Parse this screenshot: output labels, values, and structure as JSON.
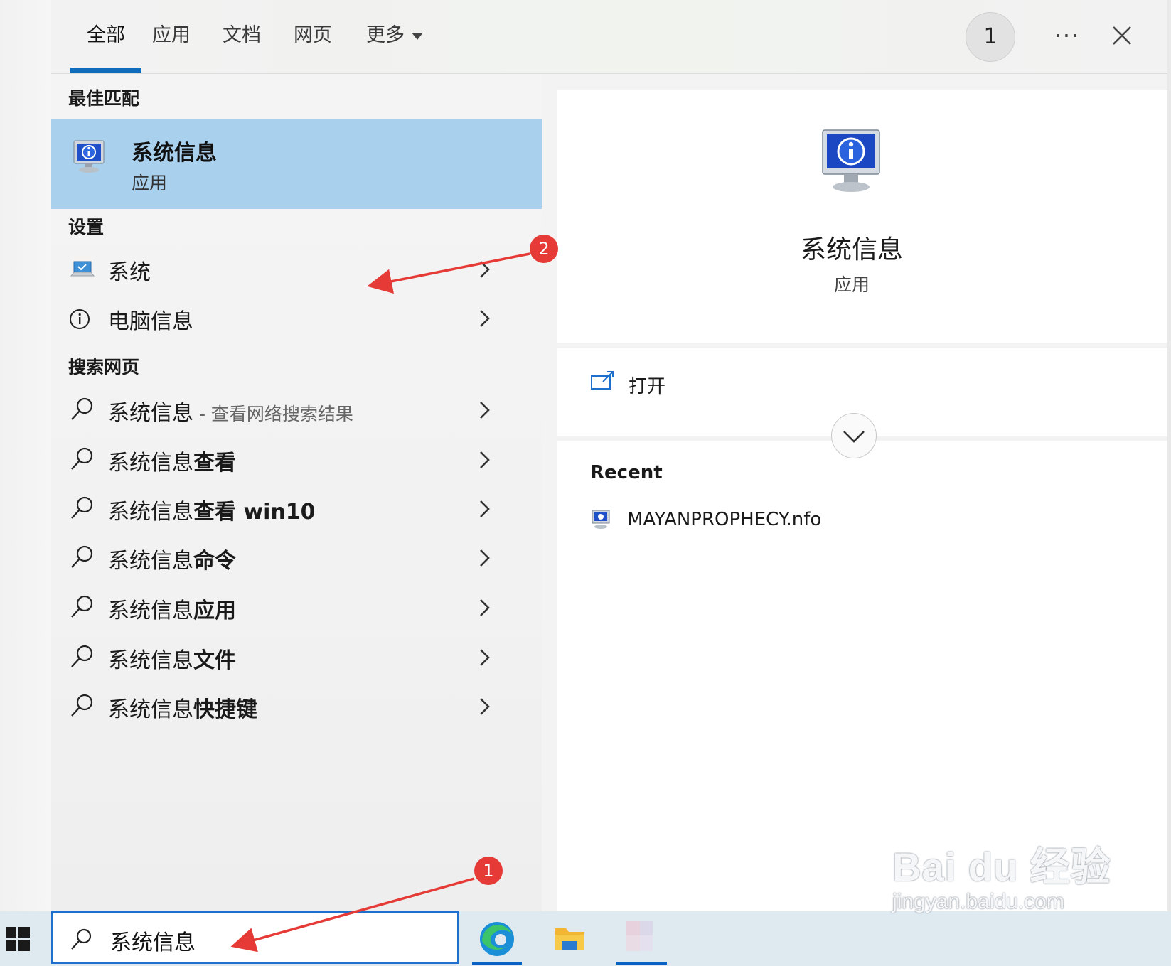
{
  "tabs": [
    {
      "label": "全部",
      "active": true
    },
    {
      "label": "应用"
    },
    {
      "label": "文档"
    },
    {
      "label": "网页"
    },
    {
      "label": "更多"
    }
  ],
  "header": {
    "count_badge": "1",
    "more_label": "···"
  },
  "best_match": {
    "section_title": "最佳匹配",
    "title": "系统信息",
    "subtitle": "应用"
  },
  "settings": {
    "section_title": "设置",
    "items": [
      {
        "label": "系统",
        "icon": "laptop-icon"
      },
      {
        "label": "电脑信息",
        "icon": "info-icon"
      }
    ]
  },
  "web": {
    "section_title": "搜索网页",
    "items": [
      {
        "prefix": "系统信息",
        "suffix": " - 查看网络搜索结果"
      },
      {
        "prefix": "系统信息",
        "bold": "查看"
      },
      {
        "prefix": "系统信息",
        "bold": "查看 win10"
      },
      {
        "prefix": "系统信息",
        "bold": "命令"
      },
      {
        "prefix": "系统信息",
        "bold": "应用"
      },
      {
        "prefix": "系统信息",
        "bold": "文件"
      },
      {
        "prefix": "系统信息",
        "bold": "快捷键"
      }
    ]
  },
  "detail": {
    "title": "系统信息",
    "subtitle": "应用",
    "open_label": "打开",
    "recent_title": "Recent",
    "recent_items": [
      "MAYANPROPHECY.nfo"
    ]
  },
  "taskbar": {
    "search_value": "系统信息"
  },
  "annotations": [
    "1",
    "2"
  ],
  "watermark": {
    "logo": "Bai du 经验",
    "url": "jingyan.baidu.com"
  },
  "colors": {
    "accent": "#0f6cbd",
    "selection": "#a9d0ed",
    "annotation": "#e53a35"
  }
}
